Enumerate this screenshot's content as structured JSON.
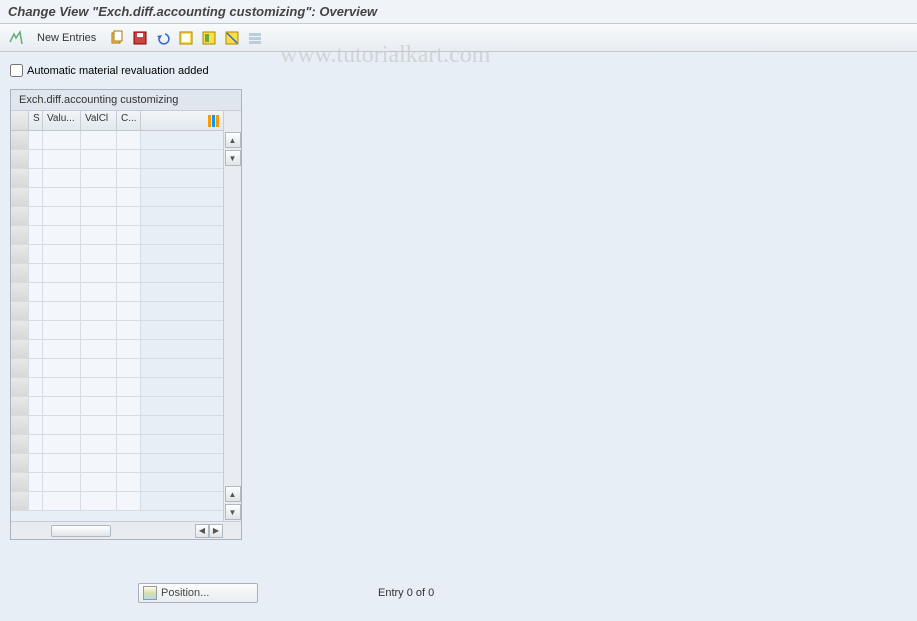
{
  "title": "Change View \"Exch.diff.accounting customizing\": Overview",
  "toolbar": {
    "new_entries": "New Entries"
  },
  "checkbox_label": "Automatic material revaluation added",
  "grid": {
    "title": "Exch.diff.accounting customizing",
    "columns": {
      "s": "S",
      "valu": "Valu...",
      "valcl": "ValCl",
      "c": "C..."
    }
  },
  "position_label": "Position...",
  "entry_text": "Entry 0 of 0",
  "watermark": "www.tutorialkart.com"
}
